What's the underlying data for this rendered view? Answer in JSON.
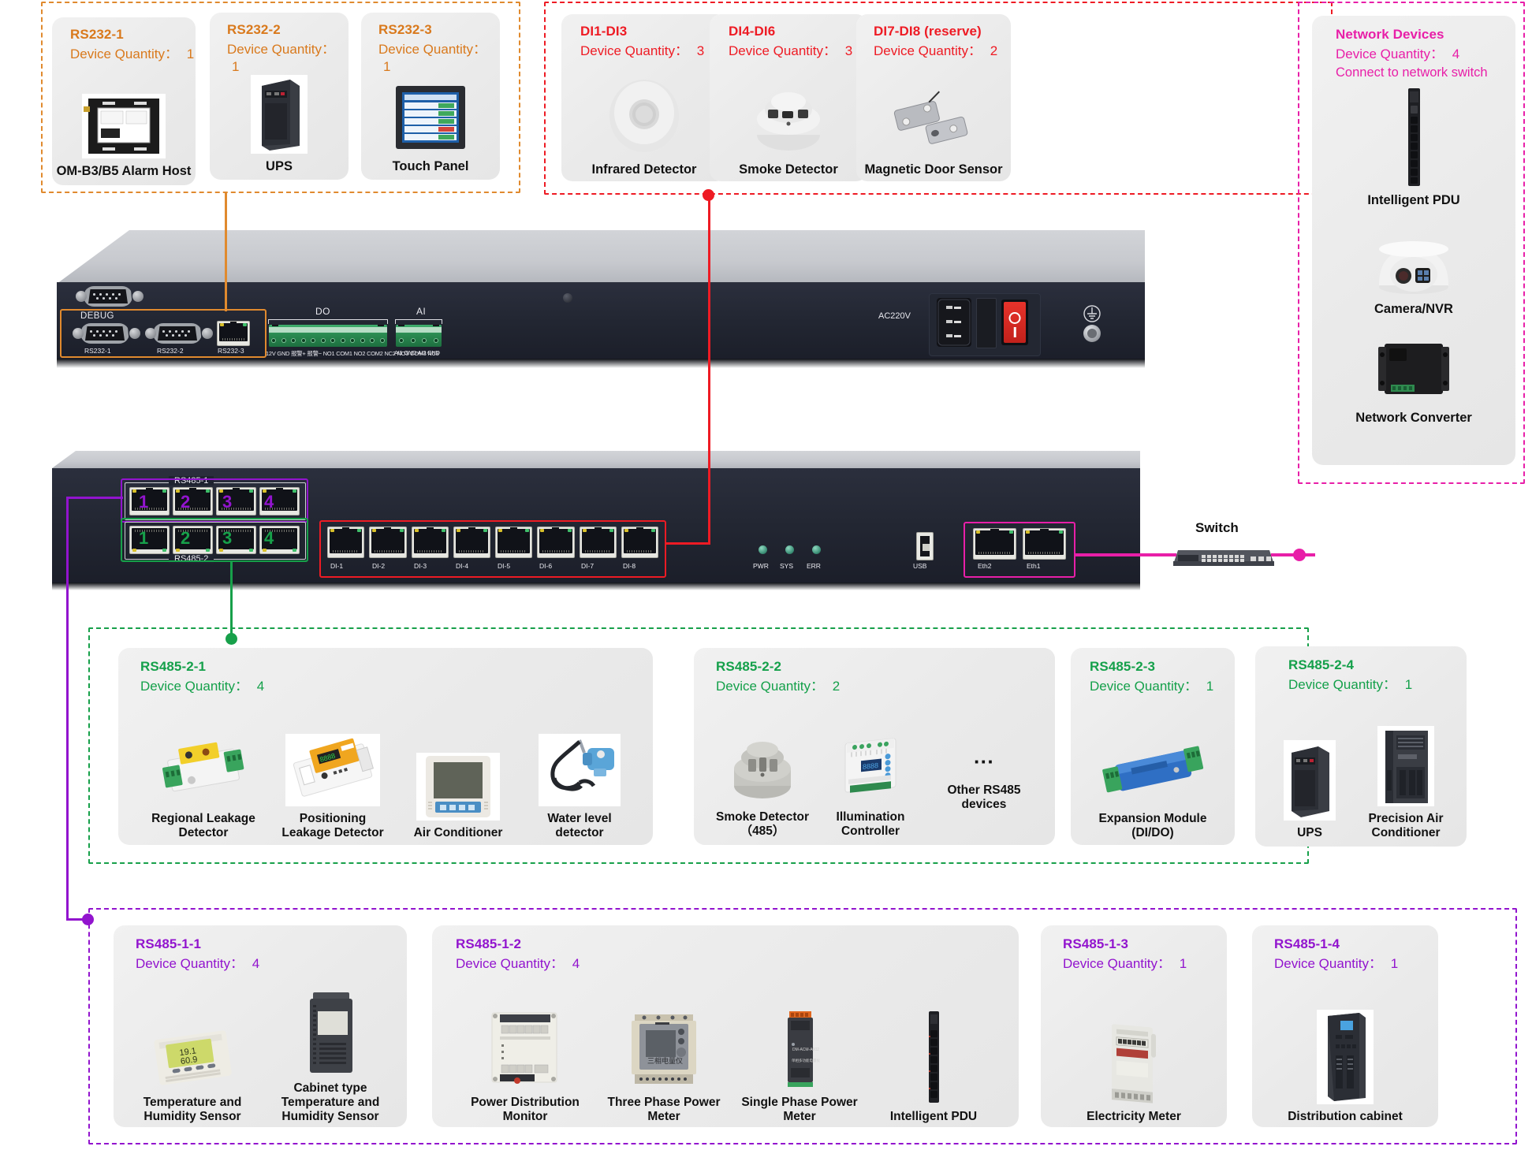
{
  "groups": {
    "rs232": {
      "accent": "#D9791C",
      "cards": [
        {
          "id": "RS232-1",
          "qty_label": "Device Quantity：",
          "qty": "1",
          "devices": [
            {
              "name": "OM-B3/B5 Alarm Host",
              "icon": "alarm-host"
            }
          ]
        },
        {
          "id": "RS232-2",
          "qty_label": "Device Quantity：",
          "qty": "1",
          "devices": [
            {
              "name": "UPS",
              "icon": "ups-tower"
            }
          ]
        },
        {
          "id": "RS232-3",
          "qty_label": "Device Quantity：",
          "qty": "1",
          "devices": [
            {
              "name": "Touch  Panel",
              "icon": "touch-panel"
            }
          ]
        }
      ]
    },
    "di": {
      "accent": "#EE1B24",
      "cards": [
        {
          "id": "DI1-DI3",
          "qty_label": "Device Quantity：",
          "qty": "3",
          "devices": [
            {
              "name": "Infrared Detector",
              "icon": "infrared-detector"
            }
          ]
        },
        {
          "id": "DI4-DI6",
          "qty_label": "Device Quantity：",
          "qty": "3",
          "devices": [
            {
              "name": "Smoke Detector",
              "icon": "smoke-detector"
            }
          ]
        },
        {
          "id": "DI7-DI8 (reserve)",
          "qty_label": "Device Quantity：",
          "qty": "2",
          "devices": [
            {
              "name": "Magnetic Door Sensor",
              "icon": "door-sensor"
            }
          ]
        }
      ]
    },
    "network": {
      "accent": "#E81FA8",
      "title": "Network Devices",
      "qty_label": "Device Quantity：",
      "qty": "4",
      "note": "Connect to network switch",
      "devices": [
        {
          "name": "Intelligent PDU",
          "icon": "pdu-strip"
        },
        {
          "name": "Camera/NVR",
          "icon": "dome-camera"
        },
        {
          "name": "Network Converter",
          "icon": "network-converter"
        }
      ]
    },
    "rs485_2": {
      "accent": "#14A04A",
      "cards": [
        {
          "id": "RS485-2-1",
          "qty_label": "Device Quantity：",
          "qty": "4",
          "devices": [
            {
              "name": "Regional Leakage Detector",
              "icon": "leak-module-yellow"
            },
            {
              "name": "Positioning Leakage Detector",
              "icon": "leak-module-orange"
            },
            {
              "name": "Air Conditioner",
              "icon": "ac-panel"
            },
            {
              "name": "Water level detector",
              "icon": "water-level"
            }
          ]
        },
        {
          "id": "RS485-2-2",
          "qty_label": "Device Quantity：",
          "qty": "2",
          "devices": [
            {
              "name": "Smoke Detector（485）",
              "icon": "smoke-detector-485"
            },
            {
              "name": "Illumination Controller",
              "icon": "din-controller"
            },
            {
              "name": "Other RS485 devices",
              "icon": "ellipsis"
            }
          ]
        },
        {
          "id": "RS485-2-3",
          "qty_label": "Device Quantity：",
          "qty": "1",
          "devices": [
            {
              "name": "Expansion Module (DI/DO)",
              "icon": "expansion-module"
            }
          ]
        },
        {
          "id": "RS485-2-4",
          "qty_label": "Device Quantity：",
          "qty": "1",
          "devices": [
            {
              "name": "UPS",
              "icon": "ups-tower"
            },
            {
              "name": "Precision Air Conditioner",
              "icon": "precision-ac"
            }
          ]
        }
      ]
    },
    "rs485_1": {
      "accent": "#9214CE",
      "cards": [
        {
          "id": "RS485-1-1",
          "qty_label": "Device Quantity：",
          "qty": "4",
          "devices": [
            {
              "name": "Temperature and Humidity Sensor",
              "icon": "th-sensor"
            },
            {
              "name": "Cabinet type Temperature and Humidity Sensor",
              "icon": "cabinet-th-sensor"
            }
          ]
        },
        {
          "id": "RS485-1-2",
          "qty_label": "Device Quantity：",
          "qty": "4",
          "devices": [
            {
              "name": "Power Distribution Monitor",
              "icon": "pdm-module"
            },
            {
              "name": "Three Phase Power Meter",
              "icon": "three-phase-meter"
            },
            {
              "name": "Single Phase Power Meter",
              "icon": "single-phase-meter"
            },
            {
              "name": "Intelligent PDU",
              "icon": "pdu-strip"
            }
          ]
        },
        {
          "id": "RS485-1-3",
          "qty_label": "Device Quantity：",
          "qty": "1",
          "devices": [
            {
              "name": "Electricity Meter",
              "icon": "electricity-meter"
            }
          ]
        },
        {
          "id": "RS485-1-4",
          "qty_label": "Device Quantity：",
          "qty": "1",
          "devices": [
            {
              "name": "Distribution cabinet",
              "icon": "distribution-cabinet"
            }
          ]
        }
      ]
    }
  },
  "rear_panel": {
    "debug_label": "DEBUG",
    "ports": [
      "RS232-1",
      "RS232-2",
      "RS232-3"
    ],
    "do_label": "DO",
    "do_pins": "12V  GND  报警+ 报警−  NO1 COM1 NO2 COM2 NC2  NO3 COM3 NC3",
    "ai_label": "AI",
    "ai_pins": "AI1  GND  AI2  GND",
    "ac_label": "AC220V"
  },
  "front_panel": {
    "rs485_1_label": "RS485-1",
    "rs485_2_label": "RS485-2",
    "rs485_ports": [
      "1",
      "2",
      "3",
      "4"
    ],
    "di_ports": [
      "DI-1",
      "DI-2",
      "DI-3",
      "DI-4",
      "DI-5",
      "DI-6",
      "DI-7",
      "DI-8"
    ],
    "leds": [
      "PWR",
      "SYS",
      "ERR"
    ],
    "usb_label": "USB",
    "eth_ports": [
      "Eth2",
      "Eth1"
    ]
  },
  "switch": {
    "label": "Switch"
  }
}
